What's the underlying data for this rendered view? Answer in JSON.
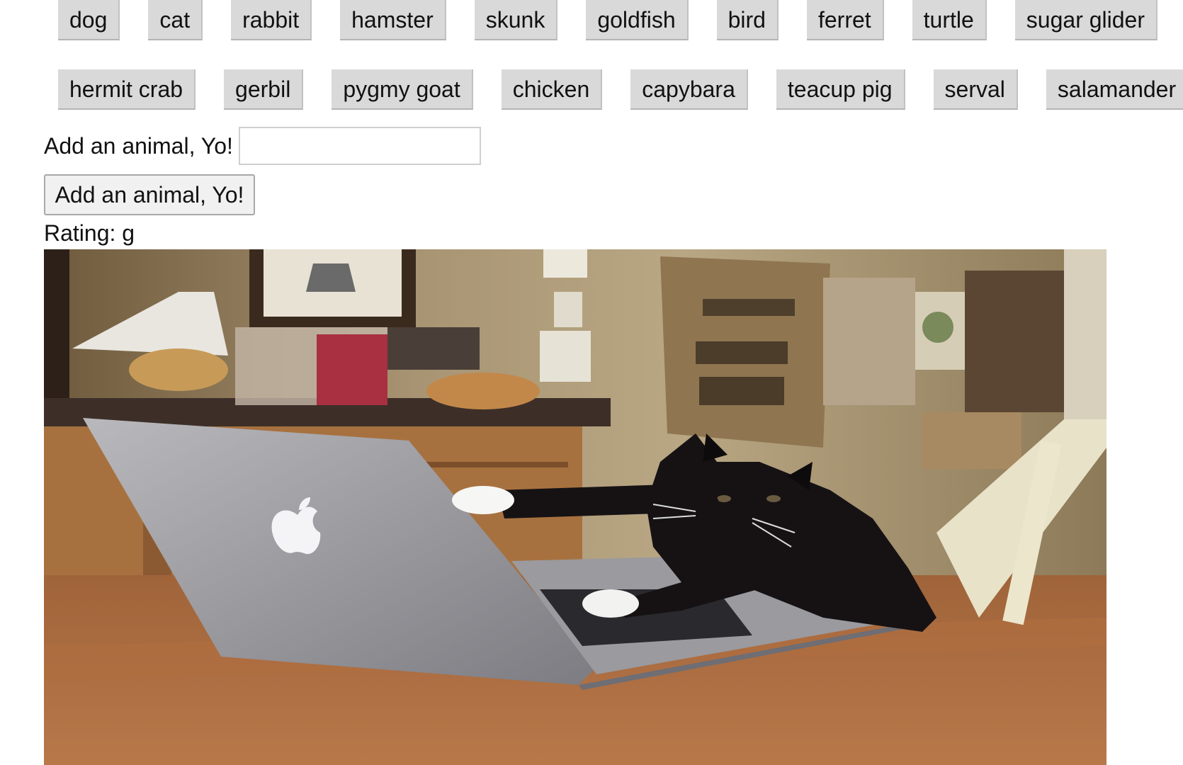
{
  "animal_buttons_row1": [
    "dog",
    "cat",
    "rabbit",
    "hamster",
    "skunk",
    "goldfish",
    "bird",
    "ferret",
    "turtle",
    "sugar glider"
  ],
  "animal_buttons_row2": [
    "hermit crab",
    "gerbil",
    "pygmy goat",
    "chicken",
    "capybara",
    "teacup pig",
    "serval",
    "salamander"
  ],
  "form": {
    "label": "Add an animal, Yo!",
    "input_value": "",
    "submit_label": "Add an animal, Yo!"
  },
  "result": {
    "rating_label": "Rating: g"
  },
  "colors": {
    "button_bg": "#d9d9d9",
    "submit_bg": "#f1f1f1",
    "page_bg": "#ffffff"
  }
}
